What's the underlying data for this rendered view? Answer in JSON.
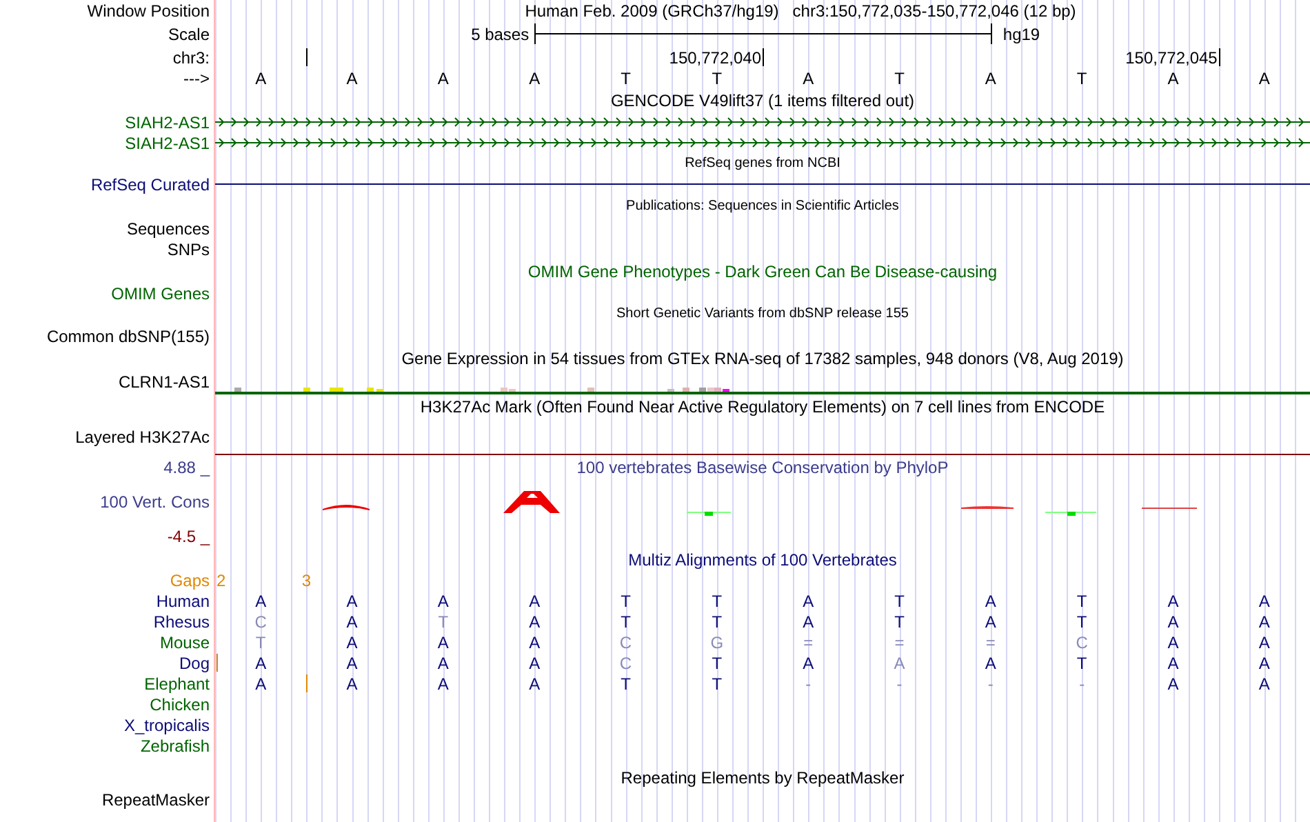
{
  "header": {
    "label": "Window Position",
    "assembly": "Human Feb. 2009 (GRCh37/hg19)",
    "position": "chr3:150,772,035-150,772,046 (12 bp)"
  },
  "scale": {
    "label": "Scale",
    "text": "5 bases",
    "db": "hg19"
  },
  "ruler": {
    "label": "chr3:"
  },
  "sequence": {
    "label": "--->",
    "bases": [
      {
        "base": "A",
        "tick": false
      },
      {
        "base": "A",
        "tick": true
      },
      {
        "base": "A",
        "tick": false
      },
      {
        "base": "A",
        "tick": false
      },
      {
        "base": "T",
        "tick": false
      },
      {
        "base": "T",
        "tick": false
      },
      {
        "base": "A",
        "tick": true,
        "tick_label": "150,772,040"
      },
      {
        "base": "T",
        "tick": false
      },
      {
        "base": "A",
        "tick": false
      },
      {
        "base": "T",
        "tick": false
      },
      {
        "base": "A",
        "tick": false
      },
      {
        "base": "A",
        "tick": true,
        "tick_label": "150,772,045"
      }
    ]
  },
  "tracks": [
    {
      "kind": "title",
      "text": "GENCODE V49lift37 (1 items filtered out)",
      "color": "#000000"
    },
    {
      "kind": "gene",
      "label": "SIAH2-AS1",
      "color": "#006400"
    },
    {
      "kind": "gene",
      "label": "SIAH2-AS1",
      "color": "#006400"
    },
    {
      "kind": "title_small",
      "text": "RefSeq genes from NCBI",
      "color": "#000000"
    },
    {
      "kind": "line",
      "label": "RefSeq Curated",
      "color": "#0c0c78"
    },
    {
      "kind": "title_small",
      "text": "Publications: Sequences in Scientific Articles",
      "color": "#000000"
    },
    {
      "kind": "label",
      "label": "Sequences",
      "color": "#000000"
    },
    {
      "kind": "label",
      "label": "SNPs",
      "color": "#000000"
    },
    {
      "kind": "title",
      "text": "OMIM Gene Phenotypes - Dark Green Can Be Disease-causing",
      "color": "#006400"
    },
    {
      "kind": "label",
      "label": "OMIM Genes",
      "color": "#006400"
    },
    {
      "kind": "title_small",
      "text": "Short Genetic Variants from dbSNP release 155",
      "color": "#000000"
    },
    {
      "kind": "label",
      "label": "Common dbSNP(155)",
      "color": "#000000"
    },
    {
      "kind": "title",
      "text": "Gene Expression in 54 tissues from GTEx RNA-seq of 17382 samples, 948 donors (V8, Aug 2019)",
      "color": "#000000"
    },
    {
      "kind": "bars",
      "label": "CLRN1-AS1",
      "color": "#000000"
    },
    {
      "kind": "title",
      "text": "H3K27Ac Mark (Often Found Near Active Regulatory Elements) on 7 cell lines from ENCODE",
      "color": "#000000"
    },
    {
      "kind": "layered",
      "label": "Layered H3K27Ac",
      "color": "#000000"
    }
  ],
  "conservation": {
    "title": "100 vertebrates Basewise Conservation by PhyloP",
    "label": "100 Vert. Cons",
    "max": "4.88 _",
    "min": "-4.5 _"
  },
  "multiz": {
    "title": "Multiz Alignments of 100 Vertebrates",
    "gaps_label": "Gaps",
    "species": [
      {
        "name": "Human",
        "color": "#0c0c78",
        "bases": [
          {
            "base": "A",
            "dim": false
          },
          {
            "base": "A",
            "dim": false
          },
          {
            "base": "A",
            "dim": false
          },
          {
            "base": "A",
            "dim": false
          },
          {
            "base": "T",
            "dim": false
          },
          {
            "base": "T",
            "dim": false
          },
          {
            "base": "A",
            "dim": false
          },
          {
            "base": "T",
            "dim": false
          },
          {
            "base": "A",
            "dim": false
          },
          {
            "base": "T",
            "dim": false
          },
          {
            "base": "A",
            "dim": false
          },
          {
            "base": "A",
            "dim": false
          }
        ]
      },
      {
        "name": "Rhesus",
        "color": "#0c0c78",
        "bases": [
          {
            "base": "C",
            "dim": true
          },
          {
            "base": "A",
            "dim": false
          },
          {
            "base": "T",
            "dim": true
          },
          {
            "base": "A",
            "dim": false
          },
          {
            "base": "T",
            "dim": false
          },
          {
            "base": "T",
            "dim": false
          },
          {
            "base": "A",
            "dim": false
          },
          {
            "base": "T",
            "dim": false
          },
          {
            "base": "A",
            "dim": false
          },
          {
            "base": "T",
            "dim": false
          },
          {
            "base": "A",
            "dim": false
          },
          {
            "base": "A",
            "dim": false
          }
        ]
      },
      {
        "name": "Mouse",
        "color": "#006400",
        "bases": [
          {
            "base": "T",
            "dim": true
          },
          {
            "base": "A",
            "dim": false
          },
          {
            "base": "A",
            "dim": false
          },
          {
            "base": "A",
            "dim": false
          },
          {
            "base": "C",
            "dim": true
          },
          {
            "base": "G",
            "dim": true
          },
          {
            "base": "=",
            "dim": true
          },
          {
            "base": "=",
            "dim": true
          },
          {
            "base": "=",
            "dim": true
          },
          {
            "base": "C",
            "dim": true
          },
          {
            "base": "A",
            "dim": false
          },
          {
            "base": "A",
            "dim": false
          }
        ]
      },
      {
        "name": "Dog",
        "color": "#0c0c78",
        "bases": [
          {
            "base": "A",
            "dim": false,
            "insert": "2"
          },
          {
            "base": "A",
            "dim": false
          },
          {
            "base": "A",
            "dim": false
          },
          {
            "base": "A",
            "dim": false
          },
          {
            "base": "C",
            "dim": true
          },
          {
            "base": "T",
            "dim": false
          },
          {
            "base": "A",
            "dim": false
          },
          {
            "base": "A",
            "dim": true
          },
          {
            "base": "A",
            "dim": false
          },
          {
            "base": "T",
            "dim": false
          },
          {
            "base": "A",
            "dim": false
          },
          {
            "base": "A",
            "dim": false
          }
        ]
      },
      {
        "name": "Elephant",
        "color": "#006400",
        "bases": [
          {
            "base": "A",
            "dim": false
          },
          {
            "base": "A",
            "dim": false,
            "insert": "3"
          },
          {
            "base": "A",
            "dim": false
          },
          {
            "base": "A",
            "dim": false
          },
          {
            "base": "T",
            "dim": false
          },
          {
            "base": "T",
            "dim": false
          },
          {
            "base": "-",
            "dim": true
          },
          {
            "base": "-",
            "dim": true
          },
          {
            "base": "-",
            "dim": true
          },
          {
            "base": "-",
            "dim": true
          },
          {
            "base": "A",
            "dim": false
          },
          {
            "base": "A",
            "dim": false
          }
        ]
      },
      {
        "name": "Chicken",
        "color": "#006400"
      },
      {
        "name": "X_tropicalis",
        "color": "#0c0c78"
      },
      {
        "name": "Zebrafish",
        "color": "#006400"
      }
    ]
  },
  "repeats": {
    "title": "Repeating Elements by RepeatMasker",
    "label": "RepeatMasker"
  }
}
